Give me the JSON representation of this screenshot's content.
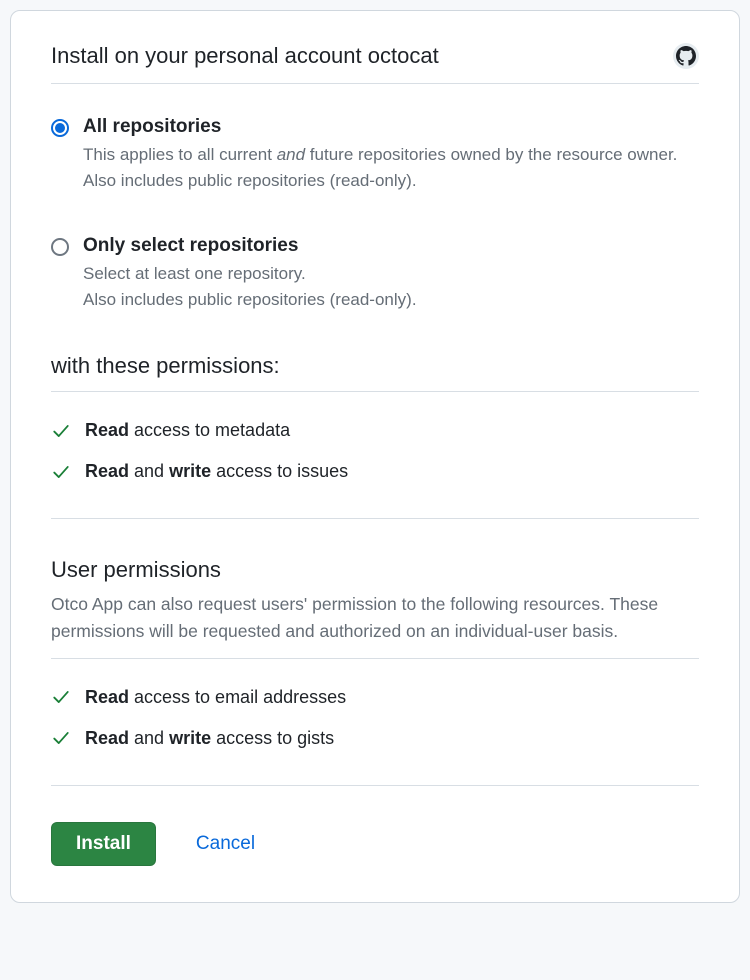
{
  "header": {
    "title": "Install on your personal account octocat"
  },
  "scope": {
    "all": {
      "title": "All repositories",
      "desc_pre": "This applies to all current ",
      "desc_em": "and",
      "desc_post": " future repositories owned by the resource owner.",
      "note": "Also includes public repositories (read-only)."
    },
    "select": {
      "title": "Only select repositories",
      "desc": "Select at least one repository.",
      "note": "Also includes public repositories (read-only)."
    }
  },
  "permissions": {
    "heading": "with these permissions:",
    "items": [
      {
        "html": "<strong>Read</strong> access to metadata"
      },
      {
        "html": "<strong>Read</strong> and <strong>write</strong> access to issues"
      }
    ]
  },
  "user_permissions": {
    "heading": "User permissions",
    "desc": "Otco App can also request users' permission to the following resources. These permissions will be requested and authorized on an individual-user basis.",
    "items": [
      {
        "html": "<strong>Read</strong> access to email addresses"
      },
      {
        "html": "<strong>Read</strong> and <strong>write</strong> access to gists"
      }
    ]
  },
  "footer": {
    "install": "Install",
    "cancel": "Cancel"
  },
  "colors": {
    "check": "#1a7f37"
  }
}
